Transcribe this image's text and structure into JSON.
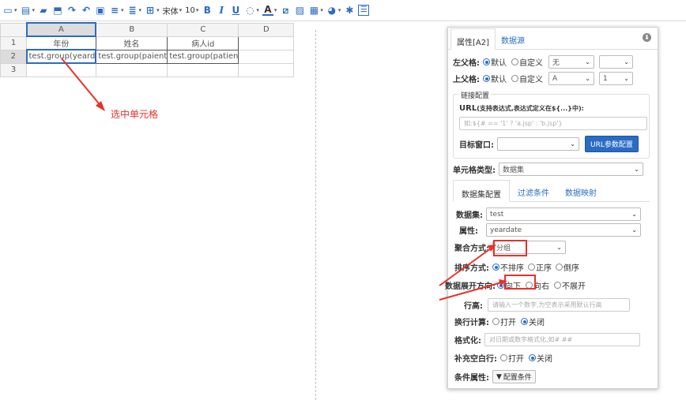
{
  "toolbar": {
    "items": [
      {
        "icon": "preview-icon",
        "glyph": "▭"
      },
      {
        "icon": "save-icon",
        "glyph": "💾"
      },
      {
        "icon": "open-icon",
        "glyph": "▰"
      },
      {
        "icon": "undo-icon",
        "glyph": "↶"
      },
      {
        "icon": "redo-icon",
        "glyph": "↷"
      },
      {
        "icon": "merge-icon",
        "glyph": "▣"
      },
      {
        "icon": "align-icon",
        "glyph": "≡"
      },
      {
        "icon": "valign-icon",
        "glyph": "≣"
      },
      {
        "icon": "border-icon",
        "glyph": "⊞"
      }
    ],
    "font_name": "宋体",
    "font_size": "10",
    "bold": "B",
    "italic": "I",
    "underline": "U",
    "font_color_letter": "A"
  },
  "sheet": {
    "columns": [
      "A",
      "B",
      "C",
      "D"
    ],
    "rows": [
      "1",
      "2",
      "3"
    ],
    "row1": [
      "年份",
      "姓名",
      "病人id"
    ],
    "row2": [
      "test.group(yeard",
      "test.group(paient",
      "test.group(patien"
    ]
  },
  "annotation": "选中单元格",
  "panel": {
    "tabs": [
      "属性[A2]",
      "数据源"
    ],
    "left_parent": {
      "label": "左父格:",
      "opt1": "默认",
      "opt2": "自定义",
      "sel1": "无",
      "sel2": ""
    },
    "top_parent": {
      "label": "上父格:",
      "opt1": "默认",
      "opt2": "自定义",
      "sel1": "A",
      "sel2": "1"
    },
    "link": {
      "legend": "链接配置",
      "url_label": "URL",
      "url_hint": "(支持表达式,表达式定义在${...}中):",
      "url_placeholder": "如:${# == '1' ? 'a.jsp' : 'b.jsp'}",
      "target_label": "目标窗口:",
      "target_value": "",
      "button": "URL参数配置"
    },
    "cell_type": {
      "label": "单元格类型:",
      "value": "数据集"
    },
    "subtabs": [
      "数据集配置",
      "过滤条件",
      "数据映射"
    ],
    "dataset": {
      "label": "数据集:",
      "value": "test"
    },
    "property": {
      "label": "属性:",
      "value": "yeardate"
    },
    "aggregate": {
      "label": "聚合方式:",
      "value": "分组"
    },
    "sort": {
      "label": "排序方式:",
      "opts": [
        "不排序",
        "正序",
        "倒序"
      ]
    },
    "expand": {
      "label": "数据展开方向:",
      "opts": [
        "向下",
        "向右",
        "不展开"
      ]
    },
    "row_height": {
      "label": "行高:",
      "placeholder": "请输入一个数字,为空表示采用默认行高"
    },
    "wrap": {
      "label": "换行计算:",
      "opts": [
        "打开",
        "关闭"
      ]
    },
    "format": {
      "label": "格式化:",
      "placeholder": "对日期或数字格式化,如# ##"
    },
    "fill_blank": {
      "label": "补充空白行:",
      "opts": [
        "打开",
        "关闭"
      ]
    },
    "condition": {
      "label": "条件属性:",
      "button": "配置条件"
    }
  },
  "colors": {
    "accent": "#2a6cc4",
    "annotation": "#e8312a"
  }
}
